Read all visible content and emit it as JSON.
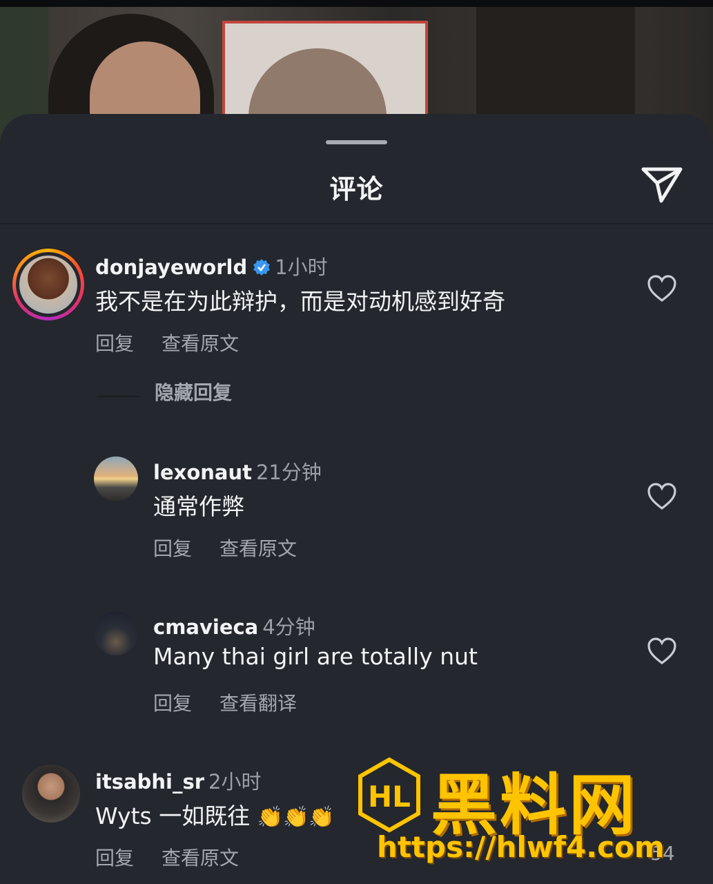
{
  "sheet": {
    "title": "评论"
  },
  "comments": [
    {
      "username": "donjayeworld",
      "time": "1小时",
      "text": "我不是在为此辩护，而是对动机感到好奇",
      "reply_label": "回复",
      "translate_label": "查看原文",
      "verified": true,
      "has_story_ring": true
    },
    {
      "username": "lexonaut",
      "time": "21分钟",
      "text": "通常作弊",
      "reply_label": "回复",
      "translate_label": "查看原文"
    },
    {
      "username": "cmavieca",
      "time": "4分钟",
      "text": "Many thai girl are totally nut",
      "reply_label": "回复",
      "translate_label": "查看翻译"
    },
    {
      "username": "itsabhi_sr",
      "time": "2小时",
      "text": "Wyts 一如既往",
      "emojis": "👏👏👏",
      "reply_label": "回复",
      "translate_label": "查看原文",
      "like_count": "54"
    }
  ],
  "thread": {
    "hide_replies_label": "隐藏回复"
  },
  "watermark": {
    "logo_text": "HL",
    "title": "黑料网",
    "url": "https://hlwf4.com"
  },
  "colors": {
    "sheet_bg": "#24272d",
    "text_primary": "#f2f3f5",
    "text_secondary": "#a3a8b0",
    "verified_blue": "#3797f0",
    "watermark_gold": "#ffc400"
  },
  "icons": {
    "send": "paper-plane-icon",
    "like": "heart-outline-icon",
    "verified": "verified-badge-icon"
  }
}
